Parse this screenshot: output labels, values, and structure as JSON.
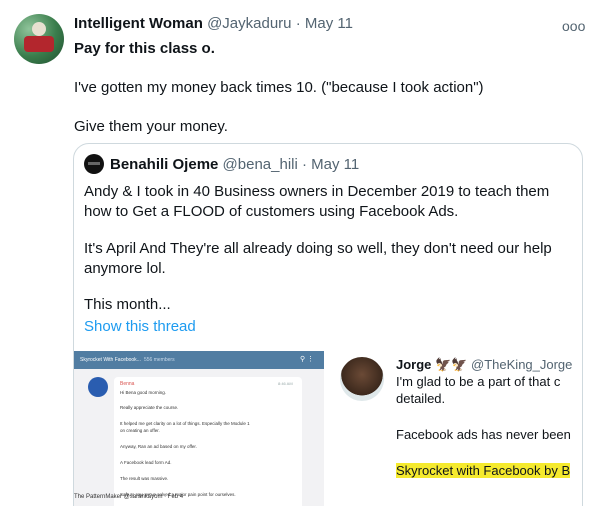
{
  "tweet": {
    "author_name": "Intelligent Woman",
    "author_handle": "@Jaykaduru",
    "separator": "·",
    "date": "May 11",
    "more": "ooo",
    "line1": "Pay for this class o.",
    "line2": "I've gotten my money back times 10. (\"because I took action\")",
    "line3": "Give them your money."
  },
  "quote": {
    "author_name": "Benahili Ojeme",
    "author_handle": "@bena_hili",
    "separator": "·",
    "date": "May 11",
    "text_lines": [
      "Andy & I took in 40 Business owners in December 2019 to teach them",
      "how to Get a FLOOD of customers using Facebook Ads.",
      "It's April And They're all already doing so well, they don't need our help",
      "anymore lol.",
      "This month..."
    ],
    "show_thread": "Show this thread"
  },
  "media_left": {
    "chat_title": "Skyrocket With Facebook...",
    "chat_members": "556 members",
    "sender": "Benna",
    "time": "8:46 AM",
    "lines": [
      "Hi Bena good morning.",
      "Really appreciate the course.",
      "It helped me get clarity on a lot of things. Especially the Module 1",
      "on creating an offer.",
      "Anyway, Ran an ad based on my offer.",
      "A Facebook lead form Ad.",
      "The result was massive.",
      "Safe to say, we've solved a major pain point for ourselves."
    ],
    "next_tweet": "The PatternMaker @sarahkayom · Feb 4"
  },
  "media_right": {
    "name": "Jorge",
    "emoji": "🦅🦅",
    "handle": "@TheKing_Jorge",
    "lines": [
      "I'm glad to be a part of that c",
      "detailed.",
      "Facebook ads has never been"
    ],
    "highlight": "Skyrocket with Facebook by B"
  },
  "colors": {
    "link": "#1d9bf0",
    "muted": "#536471",
    "border": "#cfd9de",
    "telegram_bar": "#517da2",
    "highlight": "#f5ea2e"
  }
}
